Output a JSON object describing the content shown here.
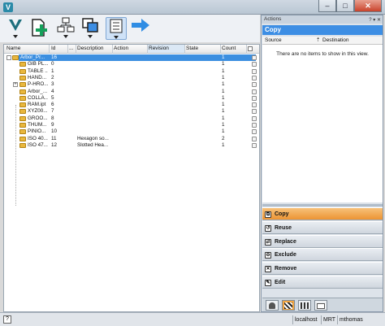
{
  "window": {
    "app_icon_letter": "V",
    "minimize": "–",
    "maximize": "□",
    "close": "✕"
  },
  "toolbar": {
    "buttons": [
      {
        "name": "vault-menu",
        "icon": "vault-logo-icon"
      },
      {
        "name": "new",
        "icon": "new-file-plus-icon"
      },
      {
        "name": "tree",
        "icon": "hierarchy-icon"
      },
      {
        "name": "copy-layout",
        "icon": "copy-squares-icon"
      },
      {
        "name": "list-view",
        "icon": "list-view-icon"
      },
      {
        "name": "go",
        "icon": "right-arrow-icon"
      }
    ]
  },
  "grid": {
    "columns": [
      "Name",
      "Id",
      "...",
      "Description",
      "Action",
      "Revision",
      "State",
      "Count"
    ],
    "rows": [
      {
        "name": "Arbor_Pr...",
        "id": "16",
        "description": "",
        "count": "1",
        "level": 0,
        "selected": true
      },
      {
        "name": "GIB PL...",
        "id": "0",
        "description": "",
        "count": "1",
        "level": 1
      },
      {
        "name": "TABLE ...",
        "id": "1",
        "description": "",
        "count": "1",
        "level": 1
      },
      {
        "name": "HAND...",
        "id": "2",
        "description": "",
        "count": "1",
        "level": 1
      },
      {
        "name": "P-HRO...",
        "id": "3",
        "description": "",
        "count": "1",
        "level": 1,
        "expandable": true
      },
      {
        "name": "Arbor_...",
        "id": "4",
        "description": "",
        "count": "1",
        "level": 1
      },
      {
        "name": "COLLA...",
        "id": "5",
        "description": "",
        "count": "1",
        "level": 1
      },
      {
        "name": "RAM.ipt",
        "id": "6",
        "description": "",
        "count": "1",
        "level": 1
      },
      {
        "name": "XYZ00...",
        "id": "7",
        "description": "",
        "count": "1",
        "level": 1
      },
      {
        "name": "GROO...",
        "id": "8",
        "description": "",
        "count": "1",
        "level": 1
      },
      {
        "name": "THUM...",
        "id": "9",
        "description": "",
        "count": "1",
        "level": 1
      },
      {
        "name": "PINIO...",
        "id": "10",
        "description": "",
        "count": "1",
        "level": 1
      },
      {
        "name": "ISO 40...",
        "id": "11",
        "description": "Hexagon so...",
        "count": "2",
        "level": 1
      },
      {
        "name": "ISO 47...",
        "id": "12",
        "description": "Slotted Hea...",
        "count": "1",
        "level": 1
      }
    ]
  },
  "actions_panel": {
    "title": "Actions",
    "header_controls": "? ▾ ✕",
    "heading": "Copy",
    "col_source": "Source",
    "col_sort": "⇡",
    "col_destination": "Destination",
    "empty_message": "There are no items to show in this view.",
    "buttons": [
      {
        "label": "Copy",
        "active": true,
        "icon": "copy-icon",
        "glyph": "⧉"
      },
      {
        "label": "Reuse",
        "icon": "reuse-icon",
        "glyph": "↺"
      },
      {
        "label": "Replace",
        "icon": "replace-icon",
        "glyph": "⇄"
      },
      {
        "label": "Exclude",
        "icon": "exclude-icon",
        "glyph": "⊖"
      },
      {
        "label": "Remove",
        "icon": "remove-icon",
        "glyph": "✕"
      },
      {
        "label": "Edit",
        "icon": "edit-icon",
        "glyph": "✎"
      }
    ],
    "bottom_tabs": [
      "director-icon",
      "film-clapper-icon",
      "grid-icon",
      "folder-icon"
    ]
  },
  "status_bar": {
    "help": "?",
    "server": "localhost",
    "vault": "MRT",
    "user": "mthomas"
  },
  "colors": {
    "selection": "#3c8fe0",
    "active_action": "#f2a541",
    "panel_title": "#3d8ee4"
  }
}
